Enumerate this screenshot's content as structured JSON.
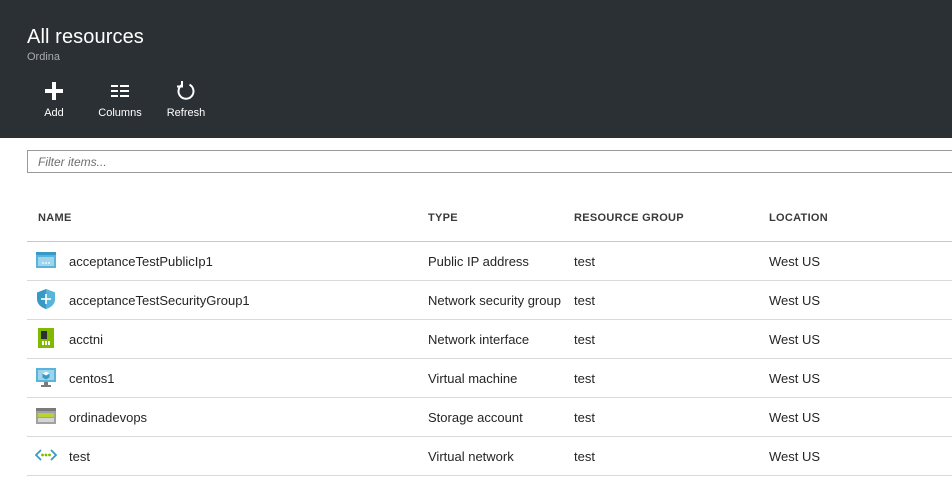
{
  "header": {
    "title": "All resources",
    "subtitle": "Ordina",
    "background": "#2b3034"
  },
  "toolbar": {
    "add_label": "Add",
    "columns_label": "Columns",
    "refresh_label": "Refresh"
  },
  "filter": {
    "placeholder": "Filter items...",
    "value": ""
  },
  "table": {
    "columns": [
      "NAME",
      "TYPE",
      "RESOURCE GROUP",
      "LOCATION"
    ],
    "rows": [
      {
        "icon": "public-ip-icon",
        "name": "acceptanceTestPublicIp1",
        "type": "Public IP address",
        "resource_group": "test",
        "location": "West US"
      },
      {
        "icon": "network-security-group-icon",
        "name": "acceptanceTestSecurityGroup1",
        "type": "Network security group",
        "resource_group": "test",
        "location": "West US"
      },
      {
        "icon": "network-interface-icon",
        "name": "acctni",
        "type": "Network interface",
        "resource_group": "test",
        "location": "West US"
      },
      {
        "icon": "virtual-machine-icon",
        "name": "centos1",
        "type": "Virtual machine",
        "resource_group": "test",
        "location": "West US"
      },
      {
        "icon": "storage-account-icon",
        "name": "ordinadevops",
        "type": "Storage account",
        "resource_group": "test",
        "location": "West US"
      },
      {
        "icon": "virtual-network-icon",
        "name": "test",
        "type": "Virtual network",
        "resource_group": "test",
        "location": "West US"
      }
    ]
  }
}
